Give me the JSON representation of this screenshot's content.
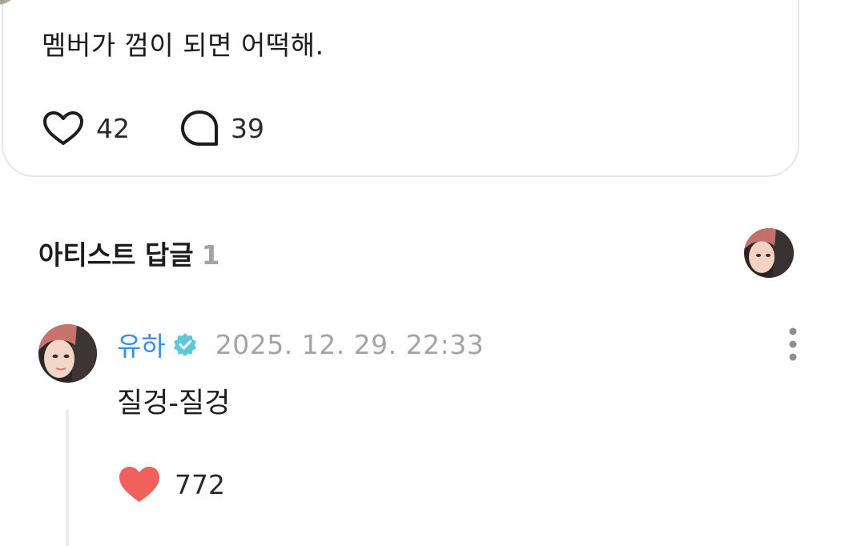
{
  "post": {
    "text": "멤버가 껌이 되면 어떡해.",
    "like_count": "42",
    "comment_count": "39"
  },
  "artist_replies": {
    "title": "아티스트 답글",
    "count": "1"
  },
  "reply": {
    "author": "유하",
    "timestamp": "2025. 12. 29. 22:33",
    "text": "질겅-질겅",
    "like_count": "772"
  },
  "colors": {
    "author": "#3d8bf2",
    "verified_badge": "#5fc8d8",
    "liked_heart": "#f0605d",
    "timestamp": "#a3a3a8",
    "section_count": "#a1a1a6"
  },
  "icons": {
    "like": "heart-outline-icon",
    "comment": "speech-bubble-icon",
    "verified": "verified-badge-icon",
    "more": "more-vertical-icon",
    "liked": "heart-filled-icon"
  }
}
